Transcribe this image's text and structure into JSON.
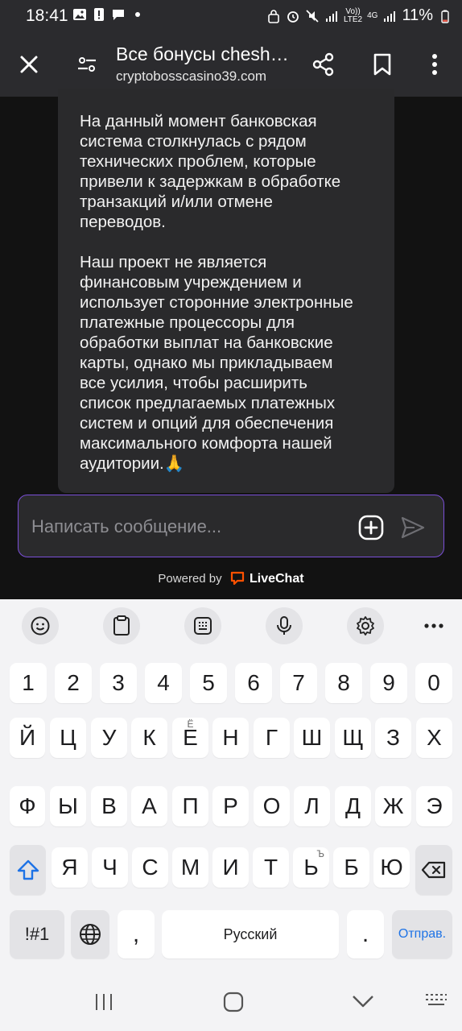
{
  "status_bar": {
    "time": "18:41",
    "network_volte": "Vo))",
    "network_lte": "LTE2",
    "network_4g": "4G",
    "battery": "11%"
  },
  "browser": {
    "title": "Все бонусы chesh…",
    "url": "cryptobosscasino39.com",
    "icons": [
      "close-icon",
      "site-settings-icon",
      "share-icon",
      "bookmark-icon",
      "more-vert-icon"
    ]
  },
  "chat": {
    "message_paragraphs": [
      "На данный момент банковская\nсистема столкнулась с рядом\nтехнических проблем, которые\nпривели к задержкам в обработке\nтранзакций и/или отмене\nпереводов.",
      "Наш проект не является\nфинансовым учреждением и\nиспользует сторонние электронные\nплатежные процессоры для\nобработки выплат на банковские\nкарты, однако мы прикладываем\nвсе усилия, чтобы расширить\nсписок предлагаемых платежных\nсистем и опций для обеспечения\nмаксимального комфорта нашей\nаудитории.🙏"
    ],
    "input_placeholder": "Написать сообщение...",
    "powered_by": "Powered by",
    "brand": "LiveChat",
    "accent_color": "#7b4fd8"
  },
  "keyboard": {
    "toolbar": [
      "emoji-icon",
      "clipboard-icon",
      "keypad-icon",
      "mic-icon",
      "settings-icon",
      "more-icon"
    ],
    "row_numbers": [
      "1",
      "2",
      "3",
      "4",
      "5",
      "6",
      "7",
      "8",
      "9",
      "0"
    ],
    "row1": [
      "Й",
      "Ц",
      "У",
      "К",
      "Е",
      "Н",
      "Г",
      "Ш",
      "Щ",
      "З",
      "Х"
    ],
    "row1_sub_e": "Ё",
    "row2": [
      "Ф",
      "Ы",
      "В",
      "А",
      "П",
      "Р",
      "О",
      "Л",
      "Д",
      "Ж",
      "Э"
    ],
    "row3": [
      "Я",
      "Ч",
      "С",
      "М",
      "И",
      "Т",
      "Ь",
      "Б",
      "Ю"
    ],
    "row3_sub_soft": "Ъ",
    "symbols_label": "!#1",
    "comma": ",",
    "space_label": "Русский",
    "period": ".",
    "enter_label": "Отправ."
  },
  "nav_bar": {
    "icons": [
      "recents-icon",
      "home-icon",
      "back-icon",
      "keyboard-hide-icon"
    ]
  }
}
